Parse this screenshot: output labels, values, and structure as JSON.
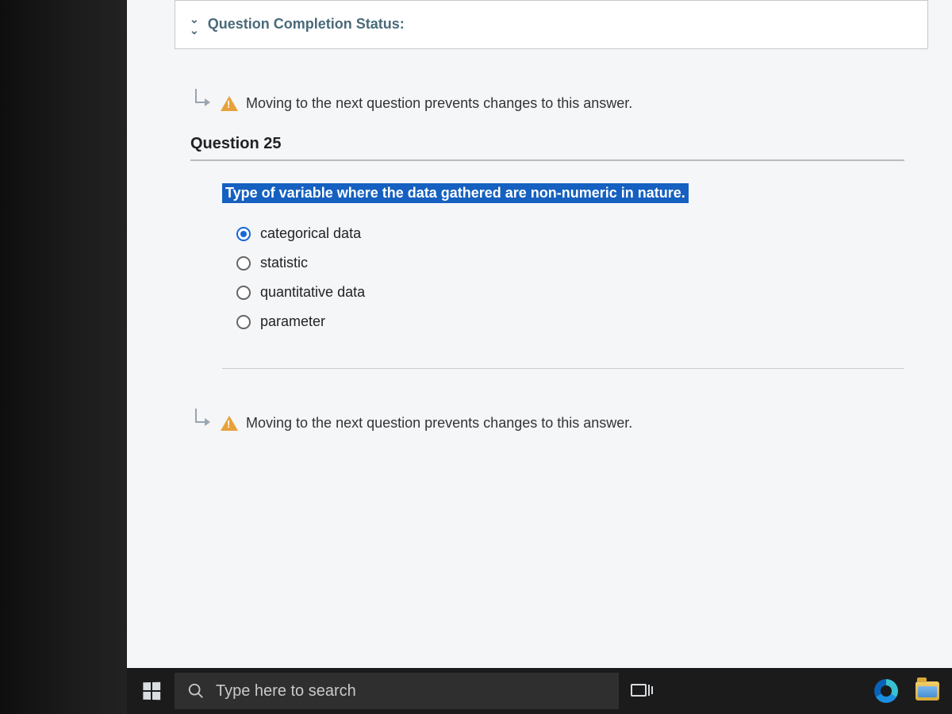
{
  "status_bar": {
    "label": "Question Completion Status:"
  },
  "warning": {
    "text": "Moving to the next question prevents changes to this answer."
  },
  "question": {
    "header": "Question 25",
    "text": "Type of variable where the data gathered are non-numeric in nature.",
    "options": [
      {
        "label": "categorical data",
        "selected": true
      },
      {
        "label": "statistic",
        "selected": false
      },
      {
        "label": "quantitative data",
        "selected": false
      },
      {
        "label": "parameter",
        "selected": false
      }
    ]
  },
  "taskbar": {
    "search_placeholder": "Type here to search"
  }
}
